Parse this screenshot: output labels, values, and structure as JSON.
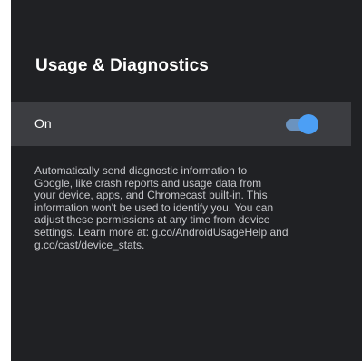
{
  "screen": {
    "title": "Usage & Diagnostics"
  },
  "toggle": {
    "label": "On",
    "state": "on",
    "accent_color": "#4c9ff5"
  },
  "description": {
    "lines": [
      "Automatically send diagnostic information to",
      "Google, like crash reports and usage data from",
      "your device, apps, and Chromecast built-in. This",
      "information won't be used to identify you. You can",
      "adjust these permissions at any time from device",
      "settings. Learn more at: g.co/AndroidUsageHelp and",
      "g.co/cast/device_stats."
    ]
  }
}
